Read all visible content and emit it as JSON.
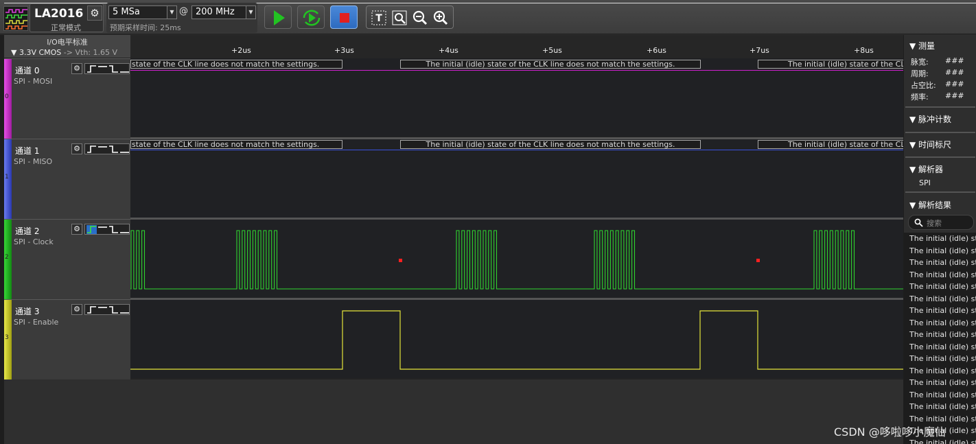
{
  "device": {
    "model": "LA2016",
    "mode": "正常模式",
    "sample_rate": "5 MSa",
    "at": "@",
    "frequency": "200 MHz",
    "sample_time": "预期采样时间: 25ms"
  },
  "io": {
    "title": "I/O电平标准",
    "standard": "▼ 3.3V CMOS",
    "vth": "-> Vth: 1.65 V"
  },
  "channels": [
    {
      "name": "通道 0",
      "sub": "SPI - MOSI",
      "num": "0",
      "color": "#c11fc1"
    },
    {
      "name": "通道 1",
      "sub": "SPI - MISO",
      "num": "1",
      "color": "#3a4fd0"
    },
    {
      "name": "通道 2",
      "sub": "SPI - Clock",
      "num": "2",
      "color": "#18a818"
    },
    {
      "name": "通道 3",
      "sub": "SPI - Enable",
      "num": "3",
      "color": "#c8c81a"
    }
  ],
  "ruler": {
    "ticks": [
      "+2us",
      "+3us",
      "+4us",
      "+5us",
      "+6us",
      "+7us",
      "+8us"
    ]
  },
  "annotations": {
    "partial": "state of the CLK line does not match the settings.",
    "full": "The initial (idle) state of the CLK line does not match the settings.",
    "cut": "The initial (idle) state of the CLK line does not match the settings."
  },
  "side": {
    "measure_title": "▼ 测量",
    "measure": [
      {
        "label": "脉宽:",
        "value": "###"
      },
      {
        "label": "周期:",
        "value": "###"
      },
      {
        "label": "占空比:",
        "value": "###"
      },
      {
        "label": "频率:",
        "value": "###"
      }
    ],
    "pulse_count": "▼ 脉冲计数",
    "cursor": "▼ 时间标尺",
    "decoder_title": "▼ 解析器",
    "decoder": "SPI",
    "results_title": "▼ 解析结果",
    "search_placeholder": "搜索",
    "results": [
      "The initial (idle) st",
      "The initial (idle) st",
      "The initial (idle) st",
      "The initial (idle) st",
      "The initial (idle) st",
      "The initial (idle) st",
      "The initial (idle) st",
      "The initial (idle) st",
      "The initial (idle) st",
      "The initial (idle) st",
      "The initial (idle) st",
      "The initial (idle) st",
      "The initial (idle) st",
      "The initial (idle) st",
      "The initial (idle) st",
      "The initial (idle) st",
      "The initial (idle) st",
      "The initial (idle) st"
    ]
  },
  "watermark": "CSDN @哆啦哆小魔仙",
  "colors": {
    "accent": "#2d6bc0",
    "clock": "#2fd62f",
    "enable": "#e6e63a",
    "marker": "#ff2020"
  }
}
